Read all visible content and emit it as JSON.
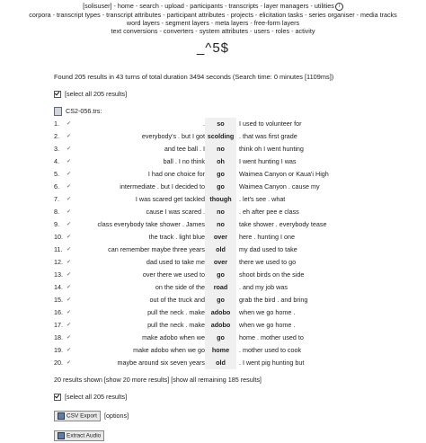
{
  "nav": {
    "line1": [
      {
        "label": "[solisuser]",
        "name": "nav-user"
      },
      {
        "label": "home",
        "name": "nav-home"
      },
      {
        "label": "search",
        "name": "nav-search"
      },
      {
        "label": "upload",
        "name": "nav-upload"
      },
      {
        "label": "participants",
        "name": "nav-participants"
      },
      {
        "label": "transcripts",
        "name": "nav-transcripts"
      },
      {
        "label": "layer managers",
        "name": "nav-layer-managers"
      },
      {
        "label": "utilities",
        "name": "nav-utilities"
      }
    ],
    "line2": [
      {
        "label": "corpora",
        "name": "nav-corpora"
      },
      {
        "label": "transcript types",
        "name": "nav-transcript-types"
      },
      {
        "label": "transcript attributes",
        "name": "nav-transcript-attributes"
      },
      {
        "label": "participant attributes",
        "name": "nav-participant-attributes"
      },
      {
        "label": "projects",
        "name": "nav-projects"
      },
      {
        "label": "elicitation tasks",
        "name": "nav-elicitation-tasks"
      },
      {
        "label": "series organiser",
        "name": "nav-series-organiser"
      },
      {
        "label": "media tracks",
        "name": "nav-media-tracks"
      }
    ],
    "line3": [
      {
        "label": "word layers",
        "name": "nav-word-layers"
      },
      {
        "label": "segment layers",
        "name": "nav-segment-layers"
      },
      {
        "label": "meta layers",
        "name": "nav-meta-layers"
      },
      {
        "label": "free-form layers",
        "name": "nav-free-form-layers"
      }
    ],
    "line4": [
      {
        "label": "text conversions",
        "name": "nav-text-conversions"
      },
      {
        "label": "converters",
        "name": "nav-converters"
      },
      {
        "label": "system attributes",
        "name": "nav-system-attributes"
      },
      {
        "label": "users",
        "name": "nav-users"
      },
      {
        "label": "roles",
        "name": "nav-roles"
      },
      {
        "label": "activity",
        "name": "nav-activity"
      }
    ],
    "separator": " - ",
    "info_icon": "i"
  },
  "search_pattern": "_^5$",
  "summary": "Found 205 results in 43 turns of total duration 3494 seconds (Search time: 0 minutes [1109ms])",
  "select_all_top": "[select all 205 results]",
  "select_all_bottom": "[select all 205 results]",
  "transcript_name": "CS2-056.trs:",
  "results": [
    {
      "n": "1.",
      "before": ".",
      "match": "so",
      "after": "I used to volunteer for"
    },
    {
      "n": "2.",
      "before": "everybody's . but I got",
      "match": "scolding",
      "after": ". that was first grade"
    },
    {
      "n": "3.",
      "before": "and tee ball . I",
      "match": "no",
      "after": "think oh I went hunting"
    },
    {
      "n": "4.",
      "before": "ball . I no think",
      "match": "oh",
      "after": "I went hunting I was"
    },
    {
      "n": "5.",
      "before": "I had one choice for",
      "match": "go",
      "after": "Waimea Canyon or Kaua'i High"
    },
    {
      "n": "6.",
      "before": "intermediate . but I decided to",
      "match": "go",
      "after": "Waimea Canyon . cause my"
    },
    {
      "n": "7.",
      "before": "I was scared get tackled",
      "match": "though",
      "after": ". let's see . what"
    },
    {
      "n": "8.",
      "before": "cause I was scared .",
      "match": "no",
      "after": ". eh after pee e class"
    },
    {
      "n": "9.",
      "before": "class everybody take shower . James",
      "match": "no",
      "after": "take shower . everybody tease"
    },
    {
      "n": "10.",
      "before": "the track . light blue",
      "match": "over",
      "after": "here . hunting I one"
    },
    {
      "n": "11.",
      "before": "can remember maybe three years",
      "match": "old",
      "after": "my dad used to take"
    },
    {
      "n": "12.",
      "before": "dad used to take me",
      "match": "over",
      "after": "there we used to go"
    },
    {
      "n": "13.",
      "before": "over there we used to",
      "match": "go",
      "after": "shoot birds on the side"
    },
    {
      "n": "14.",
      "before": "on the side of the",
      "match": "road",
      "after": ". and my job was"
    },
    {
      "n": "15.",
      "before": "out of the truck and",
      "match": "go",
      "after": "grab the bird . and bring"
    },
    {
      "n": "16.",
      "before": "pull the neck . make",
      "match": "adobo",
      "after": "when we go home ."
    },
    {
      "n": "17.",
      "before": "pull the neck . make",
      "match": "adobo",
      "after": "when we go home ."
    },
    {
      "n": "18.",
      "before": "make adobo when we",
      "match": "go",
      "after": "home . mother used to"
    },
    {
      "n": "19.",
      "before": "make adobo when we go",
      "match": "home",
      "after": ". mother used to cook"
    },
    {
      "n": "20.",
      "before": "maybe around six seven years",
      "match": "old",
      "after": ". I went pig hunting but"
    }
  ],
  "shown_text": "20 results shown [show 20 more results] [show all remaining 185 results]",
  "csv_button": "CSV Export",
  "options_link": "[options]",
  "extract_button": "Extract Audio"
}
